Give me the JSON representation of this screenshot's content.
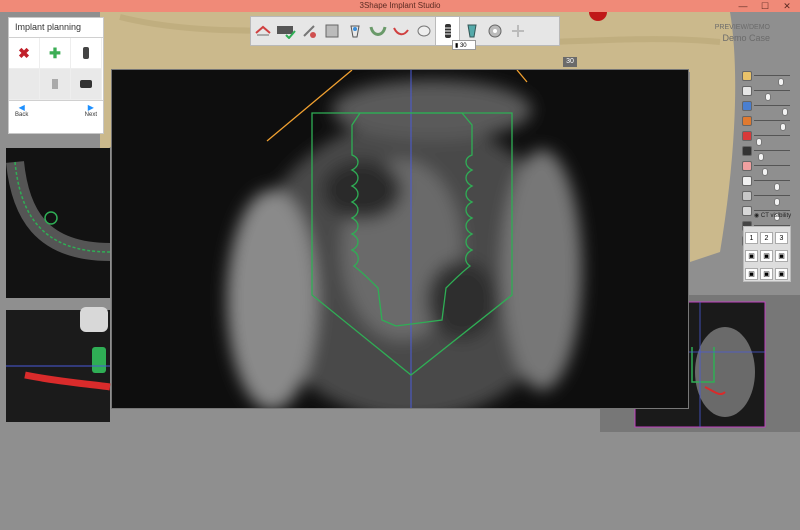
{
  "window": {
    "title": "3Shape Implant Studio",
    "min_glyph": "—",
    "max_glyph": "☐",
    "close_glyph": "✕"
  },
  "toolbar": {
    "buttons": [
      {
        "icon": "home-icon"
      },
      {
        "icon": "scan-check-icon"
      },
      {
        "icon": "tools-icon"
      },
      {
        "icon": "jaw-icon"
      },
      {
        "icon": "tooth-plan-icon"
      },
      {
        "icon": "arch-icon"
      },
      {
        "icon": "nerve-icon"
      },
      {
        "icon": "crown-icon"
      },
      {
        "icon": "implant-icon"
      },
      {
        "icon": "abutment-icon"
      },
      {
        "icon": "guide-icon"
      },
      {
        "icon": "export-icon"
      }
    ],
    "active_index": 8,
    "depth_value": "30"
  },
  "implant_panel": {
    "title": "Implant planning",
    "back_label": "Back",
    "next_label": "Next"
  },
  "case_info": {
    "line1": "PREVIEW/DEMO",
    "line2": "Demo Case"
  },
  "view_badge": "30",
  "visibility": {
    "ct_label": "CT visibility",
    "layout_buttons": [
      "1",
      "2",
      "3"
    ]
  },
  "sliders": [
    {
      "icon": "crown-icon",
      "value": 0.75,
      "color": "#e9c26a"
    },
    {
      "icon": "tooth-icon",
      "value": 0.4,
      "color": "#e6e6e6"
    },
    {
      "icon": "implant-small-icon",
      "value": 0.85,
      "color": "#4a7fd0"
    },
    {
      "icon": "guide-small-icon",
      "value": 0.8,
      "color": "#e07a30"
    },
    {
      "icon": "nerve-small-icon",
      "value": 0.15,
      "color": "#d83a3a"
    },
    {
      "icon": "ct-icon",
      "value": 0.2,
      "color": "#333333"
    },
    {
      "icon": "gum-icon",
      "value": 0.3,
      "color": "#f0a0a0"
    },
    {
      "icon": "bone-icon",
      "value": 0.65,
      "color": "#f0f0f0"
    },
    {
      "icon": "model-icon",
      "value": 0.65,
      "color": "#c8c8c8"
    },
    {
      "icon": "jaw-small-icon",
      "value": 0.65,
      "color": "#d8d8d8"
    },
    {
      "icon": "brightness-icon",
      "value": 0.25,
      "color": "#444444"
    },
    {
      "icon": "contrast-icon",
      "value": 0.25,
      "color": "#444444"
    }
  ],
  "colors": {
    "implant_outline": "#2fae55",
    "nerve": "#d92b2b",
    "guide_line": "#f0a030",
    "crosshair": "#4a5ad8",
    "model_beige": "#cbb98c",
    "title_bar": "#f08a78"
  }
}
